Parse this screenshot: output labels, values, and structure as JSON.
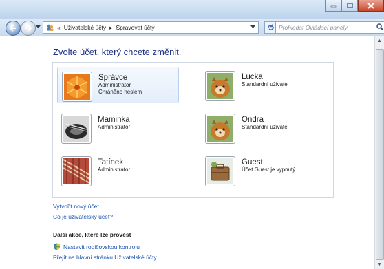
{
  "breadcrumb": {
    "sep": "«",
    "items": [
      "Uživatelské účty",
      "Spravovat účty"
    ]
  },
  "search": {
    "placeholder": "Prohledat Ovládací panely"
  },
  "heading": "Zvolte účet, který chcete změnit.",
  "accounts": [
    {
      "name": "Správce",
      "lines": [
        "Administrator",
        "Chráněno heslem"
      ],
      "picture": "flower",
      "selected": true
    },
    {
      "name": "Lucka",
      "lines": [
        "Standardní uživatel"
      ],
      "picture": "dog"
    },
    {
      "name": "Maminka",
      "lines": [
        "Administrator"
      ],
      "picture": "guitar"
    },
    {
      "name": "Ondra",
      "lines": [
        "Standardní uživatel"
      ],
      "picture": "dog"
    },
    {
      "name": "Tatínek",
      "lines": [
        "Administrator"
      ],
      "picture": "rope"
    },
    {
      "name": "Guest",
      "lines": [
        "Účet Guest je vypnutý."
      ],
      "picture": "briefcase"
    }
  ],
  "links": [
    "Vytvořit nový účet",
    "Co je uživatelský účet?"
  ],
  "more_heading": "Další akce, které lze provést",
  "tasks": [
    {
      "label": "Nastavit rodičovskou kontrolu",
      "icon": "shield-icon"
    },
    {
      "label": "Přejít na hlavní stránku Uživatelské účty",
      "icon": ""
    }
  ],
  "colors": {
    "link": "#1e55b3",
    "heading": "#1e3287"
  }
}
